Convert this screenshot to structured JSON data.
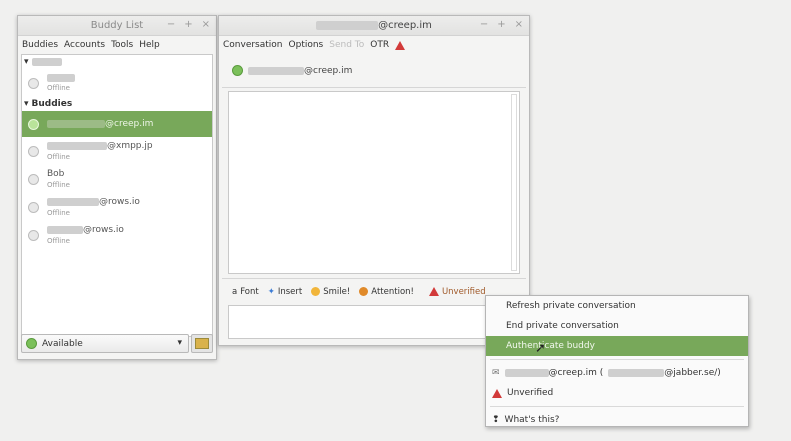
{
  "buddy_list": {
    "title": "Buddy List",
    "window_controls": [
      "−",
      "+",
      "×"
    ],
    "menu": [
      "Buddies",
      "Accounts",
      "Tools",
      "Help"
    ],
    "groups": [
      {
        "label": "Buddies"
      }
    ],
    "top_entry": {
      "status": "Offline"
    },
    "buddies": [
      {
        "name_suffix": "@creep.im",
        "status": "",
        "selected": true
      },
      {
        "name_suffix": "@xmpp.jp",
        "status": "Offline"
      },
      {
        "name": "Bob",
        "status": "Offline"
      },
      {
        "name_suffix": "@rows.io",
        "status": "Offline"
      },
      {
        "name_suffix": "@rows.io",
        "status": "Offline"
      }
    ],
    "status_selector": "Available"
  },
  "conversation": {
    "title_suffix": "@creep.im",
    "window_controls": [
      "−",
      "+",
      "×"
    ],
    "menu": [
      "Conversation",
      "Options",
      "Send To",
      "OTR"
    ],
    "contact_suffix": "@creep.im",
    "toolbar": {
      "font": "Font",
      "insert": "Insert",
      "smile": "Smile!",
      "attention": "Attention!",
      "otr_status": "Unverified"
    }
  },
  "otr_menu": {
    "items": [
      "Refresh private conversation",
      "End private conversation",
      "Authenticate buddy"
    ],
    "account_suffix": "@creep.im (",
    "account_jabber": "@jabber.se/)",
    "status": "Unverified",
    "help": "What's this?"
  },
  "colors": {
    "selection": "#78a85a",
    "online": "#7bc05a",
    "warning": "#d23a3a"
  }
}
